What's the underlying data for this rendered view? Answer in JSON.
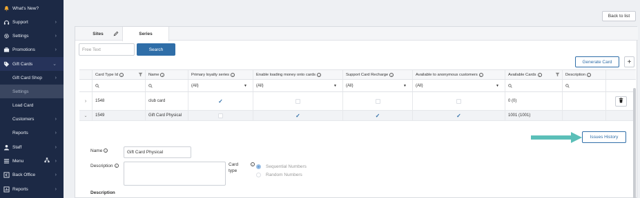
{
  "sidebar": {
    "items": [
      {
        "label": "What's New?",
        "icon": "bell-icon"
      },
      {
        "label": "Support",
        "icon": "headset-icon"
      },
      {
        "label": "Settings",
        "icon": "gear-icon"
      },
      {
        "label": "Promotions",
        "icon": "briefcase-icon"
      },
      {
        "label": "Gift Cards",
        "icon": "tag-icon"
      },
      {
        "label": "Staff",
        "icon": "person-icon"
      },
      {
        "label": "Menu",
        "icon": "menu-icon"
      },
      {
        "label": "Back Office",
        "icon": "back-office-icon"
      },
      {
        "label": "Reports",
        "icon": "reports-icon"
      }
    ],
    "subitems": [
      {
        "label": "Gift Card Shop"
      },
      {
        "label": "Settings"
      },
      {
        "label": "Load Card"
      },
      {
        "label": "Customers"
      },
      {
        "label": "Reports"
      }
    ]
  },
  "header": {
    "back_label": "Back to list"
  },
  "tabs": [
    {
      "label": "Sites"
    },
    {
      "label": "Series"
    }
  ],
  "search": {
    "placeholder": "Free Text",
    "button_label": "Search"
  },
  "actions": {
    "generate_label": "Generate Card",
    "add_label": "+"
  },
  "table": {
    "columns": [
      {
        "label": "Card Type Id"
      },
      {
        "label": "Name"
      },
      {
        "label": "Primary loyalty series"
      },
      {
        "label": "Enable loading money onto cards"
      },
      {
        "label": "Support Card Recharge"
      },
      {
        "label": "Available to anonymous customers"
      },
      {
        "label": "Available Cards"
      },
      {
        "label": "Description"
      }
    ],
    "filter_all": "(All)",
    "rows": [
      {
        "id": "1548",
        "name": "club card",
        "primary": true,
        "enable_loading": false,
        "recharge": false,
        "anonymous": false,
        "available": "0  (0)",
        "description": ""
      },
      {
        "id": "1549",
        "name": "Gift Card Physical",
        "primary": false,
        "enable_loading": true,
        "recharge": true,
        "anonymous": true,
        "available": "1001   (1001)",
        "description": ""
      }
    ]
  },
  "detail": {
    "issues_label": "Issues History",
    "name_label": "Name",
    "name_value": "Gift Card Physical",
    "description_label": "Description",
    "card_type_label_1": "Card",
    "card_type_label_2": "type",
    "radio_options": [
      {
        "label": "Sequential Numbers",
        "selected": true
      },
      {
        "label": "Random Numbers",
        "selected": false
      }
    ],
    "description_heading": "Description"
  },
  "colors": {
    "sidebar": "#1c2945",
    "accent": "#2f6ea8",
    "arrow": "#5bbfb8"
  }
}
